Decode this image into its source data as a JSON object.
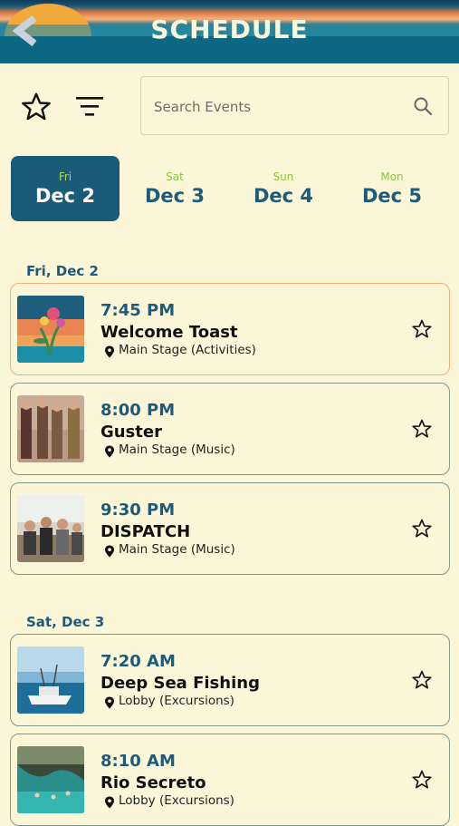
{
  "header": {
    "title": "SCHEDULE",
    "back_icon": "chevron-left-icon"
  },
  "toolbar": {
    "favorites_icon": "star-outline-icon",
    "filter_icon": "filter-icon",
    "search_placeholder": "Search Events",
    "search_icon": "search-icon"
  },
  "tabs": [
    {
      "dow": "Fri",
      "date": "Dec 2",
      "active": true
    },
    {
      "dow": "Sat",
      "date": "Dec 3",
      "active": false
    },
    {
      "dow": "Sun",
      "date": "Dec 4",
      "active": false
    },
    {
      "dow": "Mon",
      "date": "Dec 5",
      "active": false
    }
  ],
  "sections": [
    {
      "heading": "Fri, Dec 2",
      "events": [
        {
          "time": "7:45 PM",
          "title": "Welcome Toast",
          "location": "Main Stage (Activities)",
          "highlight": true
        },
        {
          "time": "8:00 PM",
          "title": "Guster",
          "location": "Main Stage (Music)"
        },
        {
          "time": "9:30 PM",
          "title": "DISPATCH",
          "location": "Main Stage (Music)"
        }
      ]
    },
    {
      "heading": "Sat, Dec 3",
      "events": [
        {
          "time": "7:20 AM",
          "title": "Deep Sea Fishing",
          "location": "Lobby (Excursions)"
        },
        {
          "time": "8:10 AM",
          "title": "Rio Secreto",
          "location": "Lobby (Excursions)"
        }
      ]
    }
  ],
  "colors": {
    "background": "#fcf6d9",
    "accent": "#1c5b7a",
    "active_tab": "#1a5b77",
    "weekday_green": "#8cc63f",
    "highlight_border": "#f2b27a"
  }
}
